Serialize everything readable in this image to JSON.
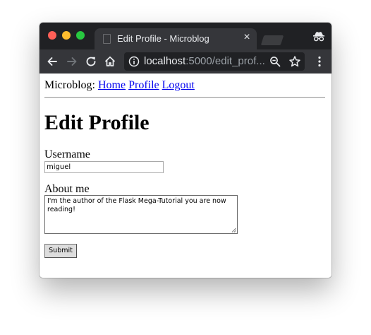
{
  "browser": {
    "tab_title": "Edit Profile - Microblog",
    "tab_close_icon": "close-icon",
    "url_host": "localhost",
    "url_rest": ":5000/edit_prof...",
    "icons": [
      "back-icon",
      "forward-icon",
      "reload-icon",
      "home-icon",
      "info-icon",
      "zoom-icon",
      "star-icon",
      "menu-icon",
      "incognito-icon"
    ]
  },
  "nav": {
    "brand": "Microblog:",
    "links": [
      "Home",
      "Profile",
      "Logout"
    ]
  },
  "page": {
    "title": "Edit Profile"
  },
  "form": {
    "username_label": "Username",
    "username_value": "miguel",
    "about_label": "About me",
    "about_value": "I'm the author of the Flask Mega-Tutorial you are now reading!",
    "submit_label": "Submit"
  },
  "colors": {
    "link": "#0000ee",
    "tab_strip": "#202124",
    "toolbar": "#35363a"
  }
}
